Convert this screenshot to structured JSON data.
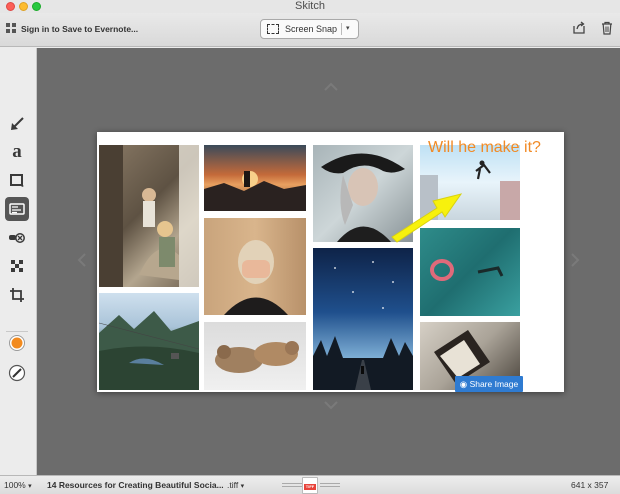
{
  "window": {
    "title": "Skitch"
  },
  "toolbar": {
    "signin_label": "Sign in to Save to Evernote...",
    "snap_label": "Screen Snap",
    "snap_arrow": "▾"
  },
  "sidebar": {
    "tools": [
      {
        "name": "arrow-tool"
      },
      {
        "name": "text-tool",
        "glyph": "a"
      },
      {
        "name": "shape-tool"
      },
      {
        "name": "stamp-tool"
      },
      {
        "name": "marker-tool"
      },
      {
        "name": "pixelate-tool"
      },
      {
        "name": "crop-tool"
      },
      {
        "name": "color-picker"
      },
      {
        "name": "line-width-picker"
      }
    ],
    "selected_color": "#f28a1e"
  },
  "canvas": {
    "annotation_text": "Will he make it?",
    "annotation_color": "#f18a25",
    "arrow_color": "#f7f10d",
    "share_image_label": "Share Image"
  },
  "status": {
    "zoom": "100%",
    "zoom_arrow": "▾",
    "filename": "14 Resources for Creating Beautiful Socia...",
    "extension": ".tiff",
    "extension_arrow": "▾",
    "file_badge": "TIFF",
    "dimensions": "641 x 357"
  }
}
